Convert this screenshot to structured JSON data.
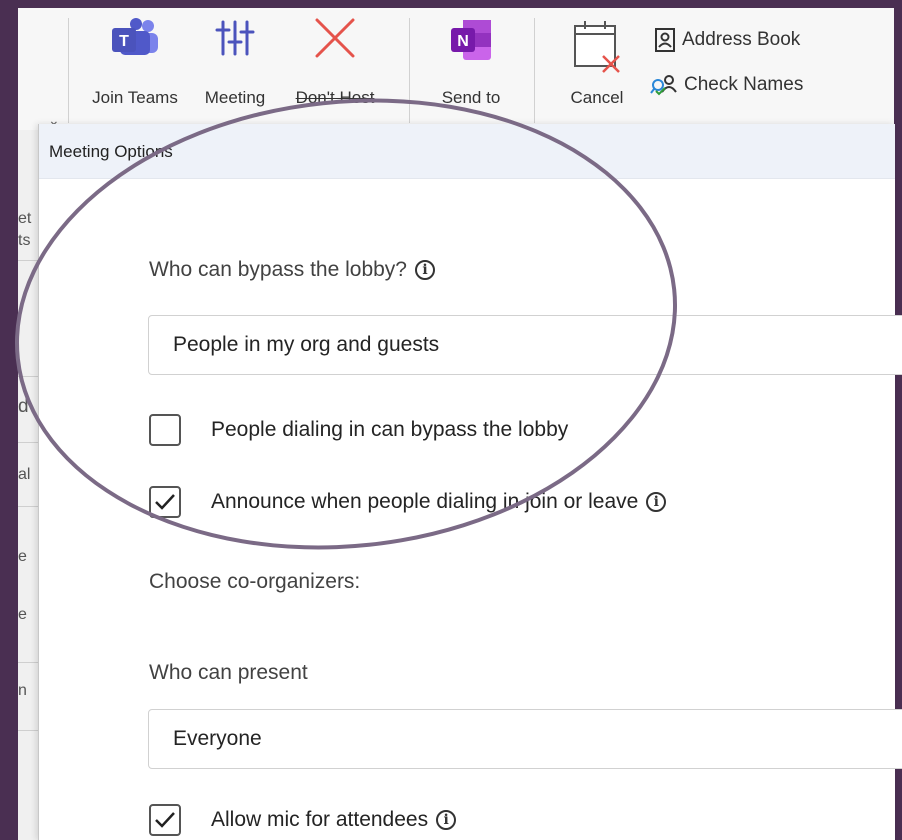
{
  "ribbon": {
    "join_teams": "Join Teams",
    "meeting": "Meeting",
    "dont_host": "Don't Host",
    "send_to": "Send to",
    "cancel": "Cancel",
    "address_book": "Address Book",
    "check_names": "Check Names"
  },
  "dialog": {
    "title": "Meeting Options",
    "lobby_label": "Who can bypass the lobby?",
    "lobby_value": "People in my org and guests",
    "dial_in_bypass": {
      "label": "People dialing in can bypass the lobby",
      "checked": false
    },
    "announce": {
      "label": "Announce when people dialing in join or leave",
      "checked": true
    },
    "coorganizers_label": "Choose co-organizers:",
    "present_label": "Who can present",
    "present_value": "Everyone",
    "allow_mic": {
      "label": "Allow mic for attendees",
      "checked": true
    }
  },
  "left_fragments": [
    "et",
    "ts",
    "d",
    "al",
    "e",
    "e",
    "n"
  ],
  "colors": {
    "frame": "#4a2f52",
    "annotation_oval": "#7b6a86",
    "teams": "#5059c9",
    "onenote": "#7719aa",
    "cancel_x": "#e5534b"
  }
}
